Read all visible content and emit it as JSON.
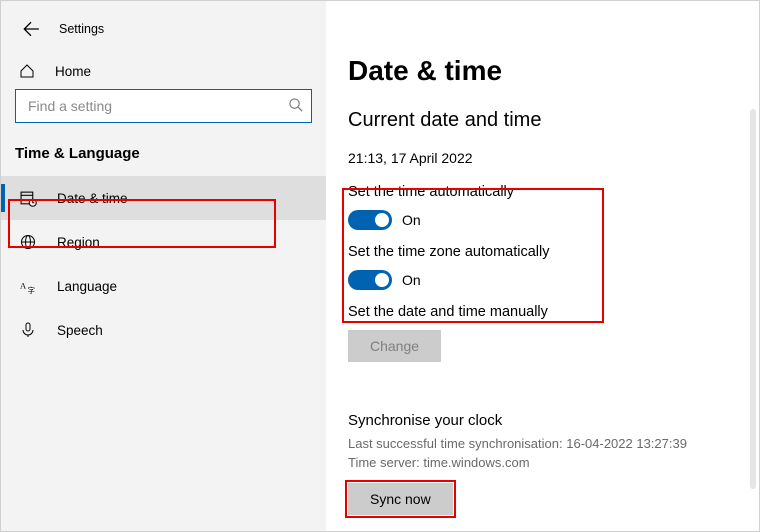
{
  "window": {
    "title": "Settings"
  },
  "sidebar": {
    "home_label": "Home",
    "search_placeholder": "Find a setting",
    "section": "Time & Language",
    "items": [
      {
        "label": "Date & time"
      },
      {
        "label": "Region"
      },
      {
        "label": "Language"
      },
      {
        "label": "Speech"
      }
    ]
  },
  "main": {
    "title": "Date & time",
    "subtitle": "Current date and time",
    "current_datetime": "21:13, 17 April 2022",
    "settings": {
      "auto_time": {
        "label": "Set the time automatically",
        "state": "On"
      },
      "auto_zone": {
        "label": "Set the time zone automatically",
        "state": "On"
      },
      "manual": {
        "label": "Set the date and time manually",
        "button": "Change"
      }
    },
    "sync": {
      "heading": "Synchronise your clock",
      "last_label": "Last successful time synchronisation:",
      "last_value": "16-04-2022 13:27:39",
      "server_label": "Time server:",
      "server_value": "time.windows.com",
      "button": "Sync now"
    }
  }
}
